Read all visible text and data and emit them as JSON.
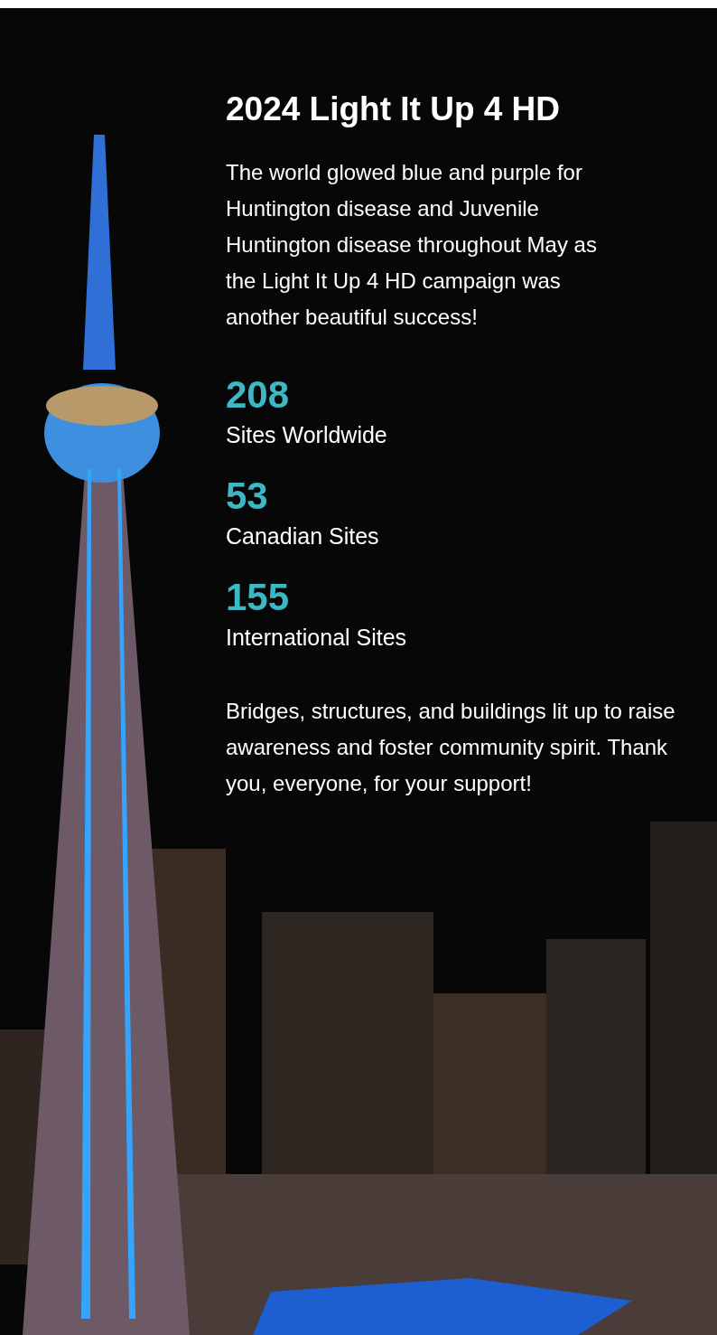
{
  "title": "2024 Light It Up 4 HD",
  "intro": "The world glowed blue and purple for Huntington disease and Juvenile Huntington disease throughout May as the Light It Up 4 HD campaign was another beautiful success!",
  "stats": [
    {
      "value": "208",
      "label": "Sites Worldwide"
    },
    {
      "value": "53",
      "label": "Canadian Sites"
    },
    {
      "value": "155",
      "label": "International Sites"
    }
  ],
  "closing": "Bridges, structures, and buildings lit up to raise awareness and foster community spirit. Thank you, everyone, for your support!"
}
